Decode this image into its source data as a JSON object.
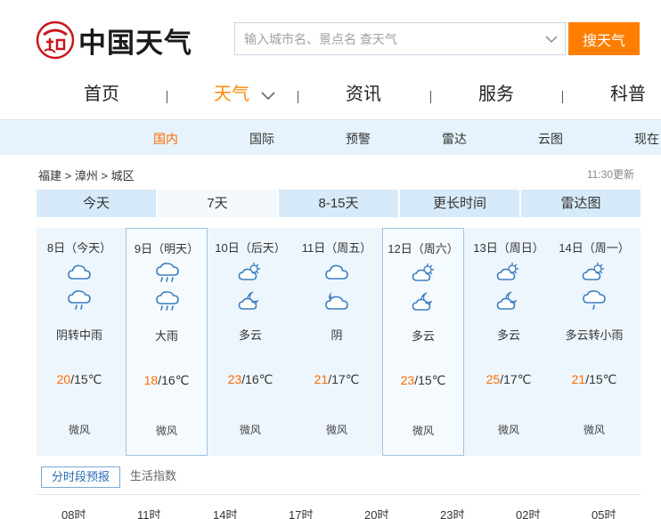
{
  "header": {
    "logo_text": "中国天气",
    "search_placeholder": "输入城市名、景点名 查天气",
    "search_button": "搜天气"
  },
  "main_nav": [
    {
      "label": "首页",
      "active": false
    },
    {
      "label": "天气",
      "active": true
    },
    {
      "label": "资讯",
      "active": false
    },
    {
      "label": "服务",
      "active": false
    },
    {
      "label": "科普",
      "active": false
    }
  ],
  "sub_nav": [
    {
      "label": "国内",
      "active": true
    },
    {
      "label": "国际",
      "active": false
    },
    {
      "label": "预警",
      "active": false
    },
    {
      "label": "雷达",
      "active": false
    },
    {
      "label": "云图",
      "active": false
    },
    {
      "label": "现在",
      "active": false
    }
  ],
  "breadcrumb": "福建 > 漳州 > 城区",
  "update_time": "11:30更新",
  "tabs": [
    {
      "label": "今天",
      "active": false
    },
    {
      "label": "7天",
      "active": true
    },
    {
      "label": "8-15天",
      "active": false
    },
    {
      "label": "更长时间",
      "active": false
    },
    {
      "label": "雷达图",
      "active": false
    }
  ],
  "days": [
    {
      "date": "8日（今天）",
      "icon_day": "cloudy-icon",
      "icon_night": "rain-icon",
      "desc": "阴转中雨",
      "high": "20",
      "low": "/15℃",
      "wind": "微风",
      "highlight": false
    },
    {
      "date": "9日（明天）",
      "icon_day": "heavy-rain-icon",
      "icon_night": "heavy-rain-icon",
      "desc": "大雨",
      "high": "18",
      "low": "/16℃",
      "wind": "微风",
      "highlight": true
    },
    {
      "date": "10日（后天）",
      "icon_day": "partly-cloudy-sun-icon",
      "icon_night": "partly-cloudy-moon-icon",
      "desc": "多云",
      "high": "23",
      "low": "/16℃",
      "wind": "微风",
      "highlight": false
    },
    {
      "date": "11日（周五）",
      "icon_day": "cloudy-icon",
      "icon_night": "cloudy-moon-icon",
      "desc": "阴",
      "high": "21",
      "low": "/17℃",
      "wind": "微风",
      "highlight": false
    },
    {
      "date": "12日（周六）",
      "icon_day": "partly-cloudy-sun-icon",
      "icon_night": "partly-cloudy-moon-icon",
      "desc": "多云",
      "high": "23",
      "low": "/15℃",
      "wind": "微风",
      "highlight": true
    },
    {
      "date": "13日（周日）",
      "icon_day": "partly-cloudy-sun-icon",
      "icon_night": "partly-cloudy-moon-icon",
      "desc": "多云",
      "high": "25",
      "low": "/17℃",
      "wind": "微风",
      "highlight": false
    },
    {
      "date": "14日（周一）",
      "icon_day": "partly-cloudy-sun-icon",
      "icon_night": "rain-icon",
      "desc": "多云转小雨",
      "high": "21",
      "low": "/15℃",
      "wind": "微风",
      "highlight": false
    }
  ],
  "bottom_tabs": [
    {
      "label": "分时段预报",
      "active": true
    },
    {
      "label": "生活指数",
      "active": false
    }
  ],
  "hours": [
    "08时",
    "11时",
    "14时",
    "17时",
    "20时",
    "23时",
    "02时",
    "05时"
  ],
  "colors": {
    "accent": "#ff7e00",
    "high_temp": "#ff6a00",
    "tab_bg": "#d6eaf9",
    "subnav_bg": "#e6f3fc",
    "icon_stroke": "#3d7fc1"
  }
}
